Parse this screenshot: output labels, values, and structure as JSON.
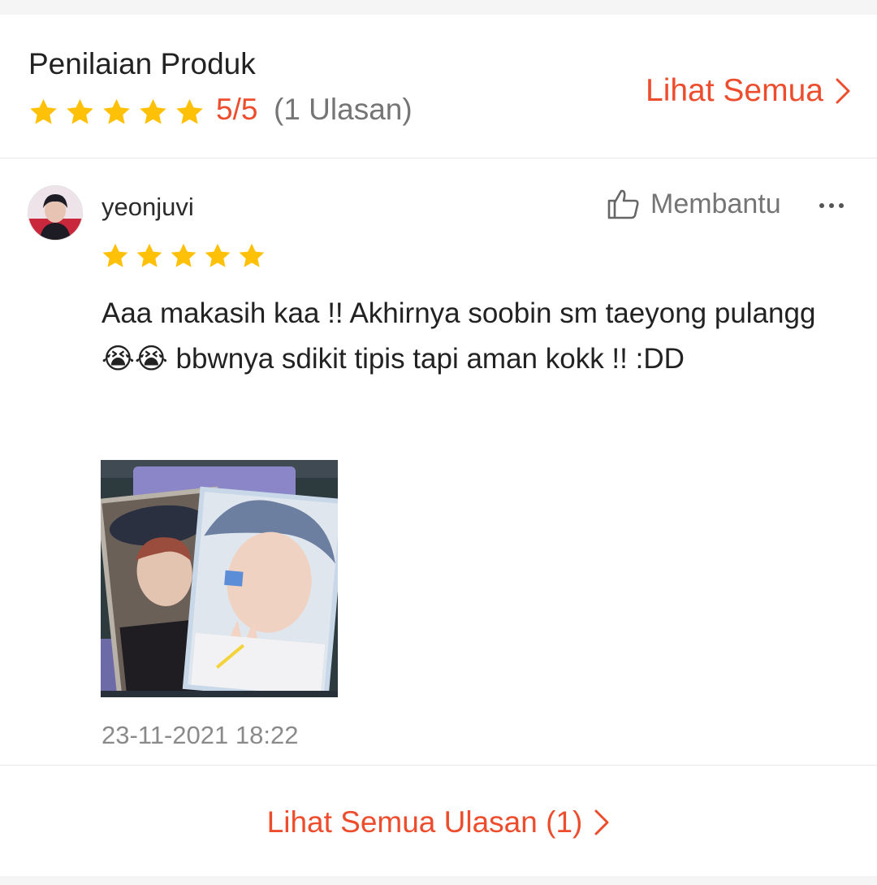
{
  "colors": {
    "accent": "#ee4d2d",
    "star": "#ffc107",
    "muted": "#757575"
  },
  "rating_header": {
    "title": "Penilaian Produk",
    "stars": 5,
    "score": "5/5",
    "count": "(1 Ulasan)",
    "see_all_label": "Lihat Semua",
    "chevron_icon": "chevron-right-icon"
  },
  "review": {
    "username": "yeonjuvi",
    "avatar_icon": "user-avatar",
    "stars": 5,
    "helpful_label": "Membantu",
    "helpful_icon": "thumbs-up-icon",
    "more_icon": "more-horizontal-icon",
    "text": "Aaa makasih kaa !! Akhirnya soobin sm taeyong pulangg😭😭 bbwnya sdikit tipis tapi aman kokk !! :DD",
    "photo_icon": "review-photo",
    "timestamp": "23-11-2021 18:22"
  },
  "footer": {
    "see_all_reviews_label": "Lihat Semua Ulasan (1)",
    "chevron_icon": "chevron-right-icon"
  }
}
